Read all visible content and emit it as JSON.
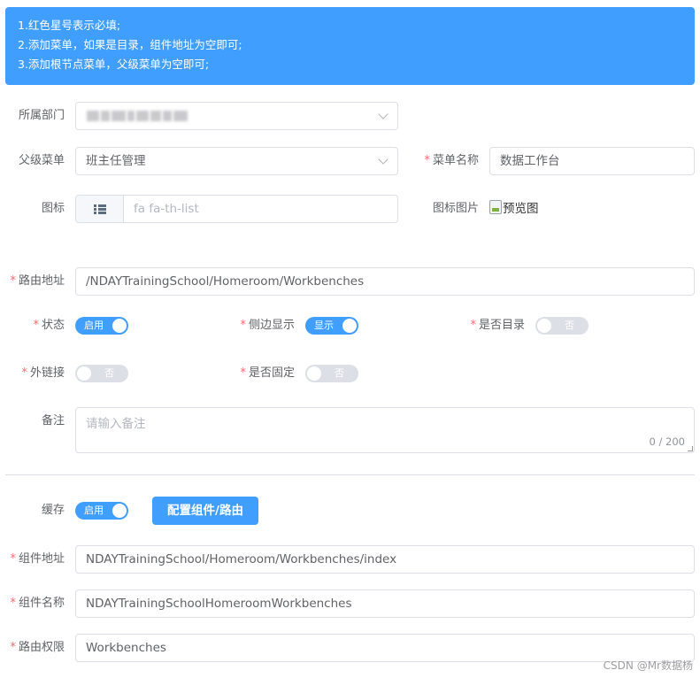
{
  "tips": [
    "1.红色星号表示必填;",
    "2.添加菜单，如果是目录，组件地址为空即可;",
    "3.添加根节点菜单，父级菜单为空即可;"
  ],
  "form": {
    "department": {
      "label": "所属部门"
    },
    "parent_menu": {
      "label": "父级菜单",
      "value": "班主任管理"
    },
    "menu_name": {
      "label": "菜单名称",
      "value": "数据工作台"
    },
    "icon": {
      "label": "图标",
      "value": "fa fa-th-list",
      "icon_name": "list-icon"
    },
    "icon_image": {
      "label": "图标图片",
      "alt": "预览图"
    },
    "route": {
      "label": "路由地址",
      "value": "/NDAYTrainingSchool/Homeroom/Workbenches"
    },
    "status": {
      "label": "状态",
      "switch_text": "启用",
      "on": true
    },
    "sidebar_display": {
      "label": "侧边显示",
      "switch_text": "显示",
      "on": true
    },
    "is_directory": {
      "label": "是否目录",
      "switch_text": "否",
      "on": false
    },
    "external_link": {
      "label": "外链接",
      "switch_text": "否",
      "on": false
    },
    "is_fixed": {
      "label": "是否固定",
      "switch_text": "否",
      "on": false
    },
    "remark": {
      "label": "备注",
      "placeholder": "请输入备注",
      "counter": "0 / 200"
    },
    "cache": {
      "label": "缓存",
      "switch_text": "启用",
      "on": true
    },
    "config_button": "配置组件/路由",
    "component_path": {
      "label": "组件地址",
      "value": "NDAYTrainingSchool/Homeroom/Workbenches/index"
    },
    "component_name": {
      "label": "组件名称",
      "value": "NDAYTrainingSchoolHomeroomWorkbenches"
    },
    "route_permission": {
      "label": "路由权限",
      "value": "Workbenches"
    }
  },
  "watermark": "CSDN @Mr数据杨",
  "colors": {
    "primary": "#409eff",
    "required": "#f56c6c",
    "border": "#dcdfe6"
  }
}
